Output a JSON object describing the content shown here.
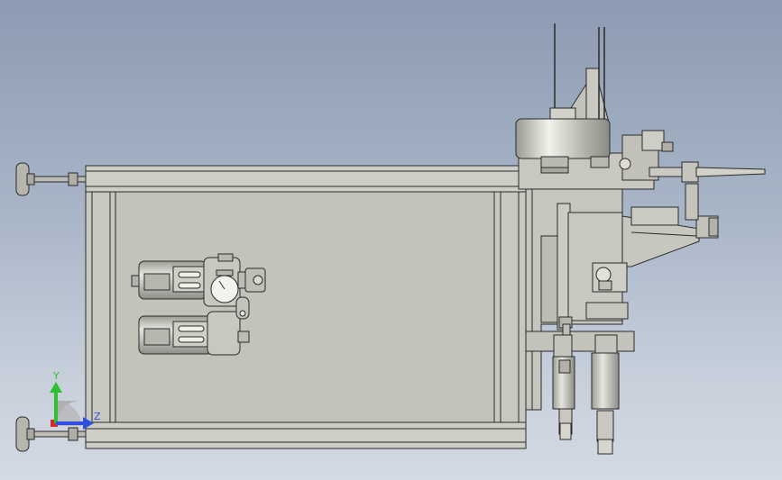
{
  "viewport": {
    "background_top": "#8c9bb2",
    "background_bottom": "#d4dae3",
    "part_fill": "#c6c5bc",
    "part_stroke": "#2a2a2a"
  },
  "triad": {
    "y_label": "Y",
    "z_label": "Z",
    "y_color": "#2ec02e",
    "z_color": "#2f4fe0",
    "x_color": "#d02a2a"
  }
}
